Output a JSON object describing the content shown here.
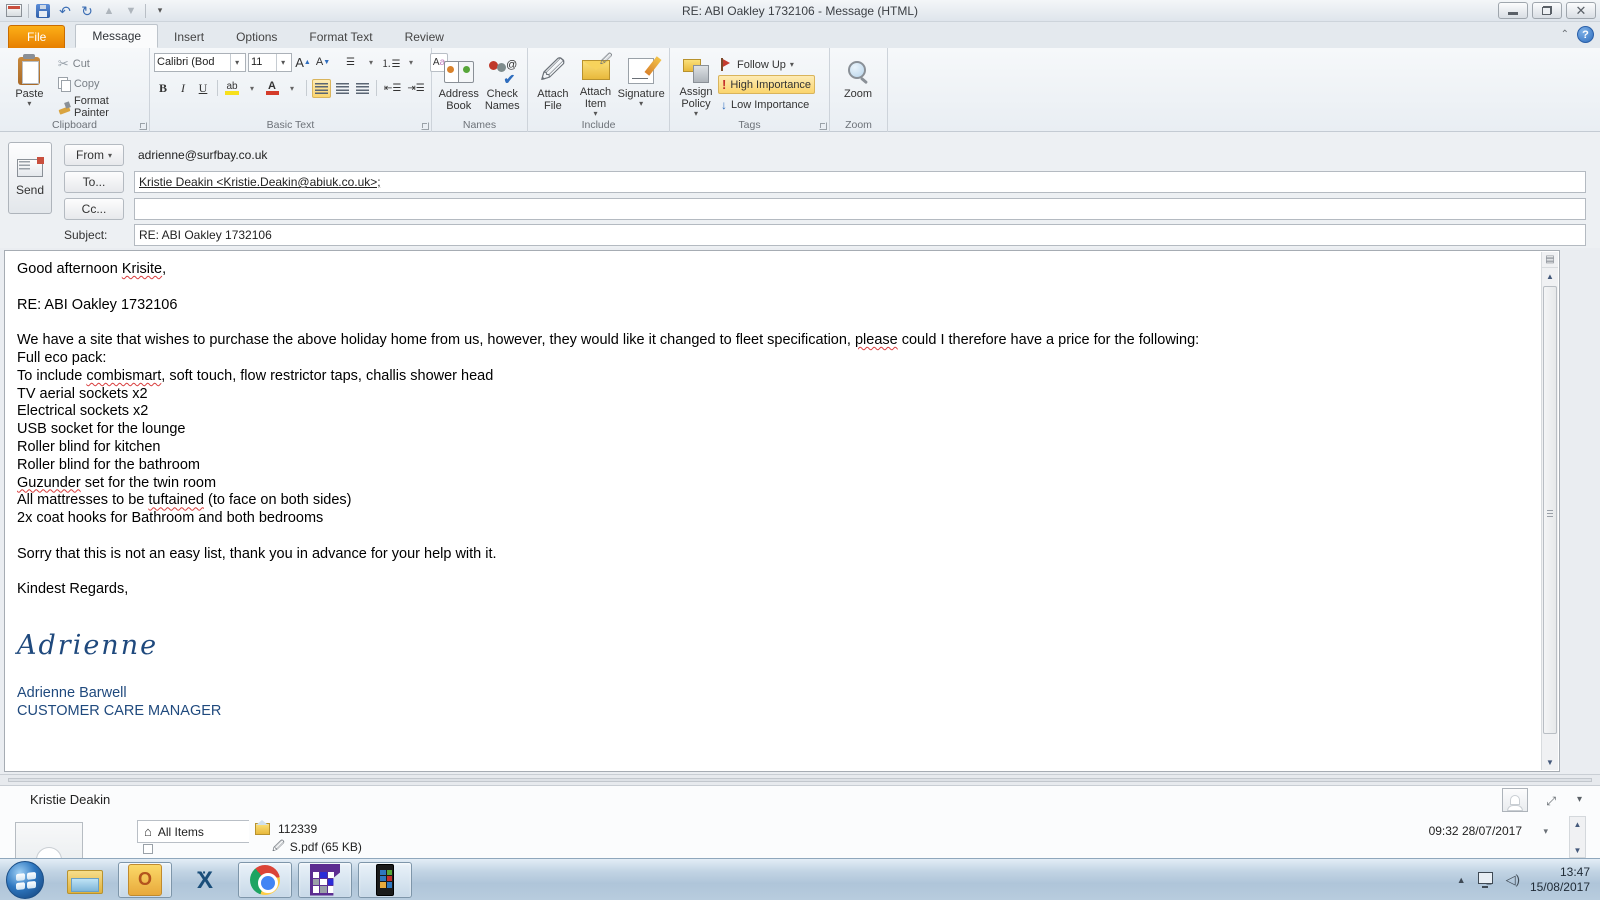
{
  "window": {
    "title": "RE: ABI Oakley 1732106  -  Message (HTML)"
  },
  "tabs": {
    "file": "File",
    "message": "Message",
    "insert": "Insert",
    "options": "Options",
    "format_text": "Format Text",
    "review": "Review"
  },
  "ribbon": {
    "clipboard": {
      "label": "Clipboard",
      "paste": "Paste",
      "cut": "Cut",
      "copy": "Copy",
      "format_painter": "Format Painter"
    },
    "basic_text": {
      "label": "Basic Text",
      "font_name": "Calibri (Bod",
      "font_size": "11",
      "bold": "B",
      "italic": "I",
      "underline": "U"
    },
    "names": {
      "label": "Names",
      "address_book": "Address Book",
      "check_names": "Check Names"
    },
    "include": {
      "label": "Include",
      "attach_file": "Attach File",
      "attach_item": "Attach Item",
      "signature": "Signature"
    },
    "tags": {
      "label": "Tags",
      "assign_policy": "Assign Policy",
      "follow_up": "Follow Up",
      "high_importance": "High Importance",
      "low_importance": "Low Importance"
    },
    "zoom": {
      "label": "Zoom",
      "button": "Zoom"
    }
  },
  "envelope": {
    "send": "Send",
    "from_label": "From",
    "from_value": "adrienne@surfbay.co.uk",
    "to_label": "To...",
    "to_value": "Kristie Deakin  <Kristie.Deakin@abiuk.co.uk>;",
    "cc_label": "Cc...",
    "cc_value": "",
    "subject_label": "Subject:",
    "subject_value": "RE: ABI Oakley 1732106"
  },
  "body": {
    "lines": [
      [
        "Good afternoon ",
        {
          "text": "Krisite",
          "misspelled": true
        },
        ","
      ],
      [
        ""
      ],
      [
        "RE: ABI Oakley 1732106"
      ],
      [
        ""
      ],
      [
        "We have a site that wishes to purchase the above holiday home from us, however, they would like it changed to fleet specification, ",
        {
          "text": "please",
          "misspelled": true
        },
        " could I therefore have a price for the following:"
      ],
      [
        "Full eco pack:"
      ],
      [
        "To include ",
        {
          "text": "combismart",
          "misspelled": true
        },
        ", soft touch, flow restrictor taps, challis shower head"
      ],
      [
        "TV aerial sockets x2"
      ],
      [
        "Electrical sockets x2"
      ],
      [
        "USB socket for the lounge"
      ],
      [
        "Roller blind for kitchen"
      ],
      [
        "Roller blind for the bathroom"
      ],
      [
        {
          "text": "Guzunder",
          "misspelled": true
        },
        " set for the twin room"
      ],
      [
        "All mattresses to be ",
        {
          "text": "tuftained",
          "misspelled": true
        },
        " (to face on both sides)"
      ],
      [
        "2x coat hooks for Bathroom and both bedrooms"
      ],
      [
        ""
      ],
      [
        "Sorry that this is not an easy list, thank you in advance for your help with it."
      ],
      [
        ""
      ],
      [
        "Kindest Regards,"
      ]
    ]
  },
  "signature": {
    "script": "Adrienne",
    "name": "Adrienne Barwell",
    "title": "CUSTOMER CARE MANAGER"
  },
  "people_pane": {
    "contact_name": "Kristie Deakin",
    "all_items_label": "All Items",
    "item_subject": "112339",
    "item_attachment": "S.pdf (65 KB)",
    "item_datetime": "09:32  28/07/2017"
  },
  "taskbar": {
    "time": "13:47",
    "date": "15/08/2017"
  },
  "colors": {
    "file_tab_orange": "#E77F00",
    "high_importance_bg": "#FBD56E",
    "signature_blue": "#1F497D",
    "squiggle_red": "#D83C3C"
  }
}
